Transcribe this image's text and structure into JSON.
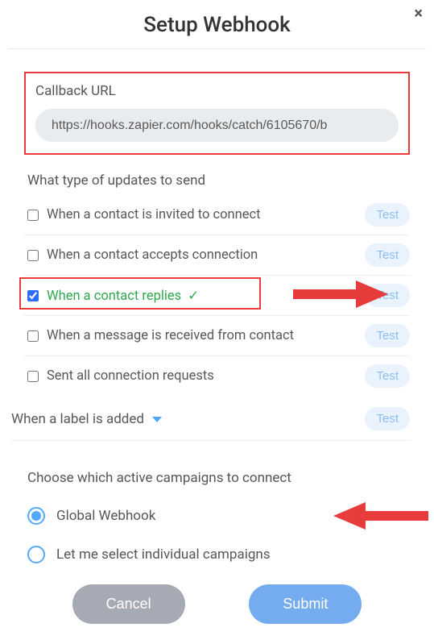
{
  "header": {
    "title": "Setup Webhook",
    "close": "×"
  },
  "callback": {
    "label": "Callback URL",
    "value": "https://hooks.zapier.com/hooks/catch/6105670/b"
  },
  "updates": {
    "label": "What type of updates to send",
    "options": [
      {
        "id": "invited",
        "label": "When a contact is invited to connect",
        "checked": false,
        "test": "Test"
      },
      {
        "id": "accepts",
        "label": "When a contact accepts connection",
        "checked": false,
        "test": "Test"
      },
      {
        "id": "replies",
        "label": "When a contact replies",
        "checked": true,
        "test": "Test"
      },
      {
        "id": "received",
        "label": "When a message is received from contact",
        "checked": false,
        "test": "Test"
      },
      {
        "id": "sentall",
        "label": "Sent all connection requests",
        "checked": false,
        "test": "Test"
      }
    ],
    "label_added": {
      "label": "When a label is added",
      "test": "Test"
    }
  },
  "campaigns": {
    "label": "Choose which active campaigns to connect",
    "options": [
      {
        "id": "global",
        "label": "Global Webhook",
        "selected": true
      },
      {
        "id": "individual",
        "label": "Let me select individual campaigns",
        "selected": false
      }
    ]
  },
  "actions": {
    "cancel": "Cancel",
    "submit": "Submit"
  }
}
